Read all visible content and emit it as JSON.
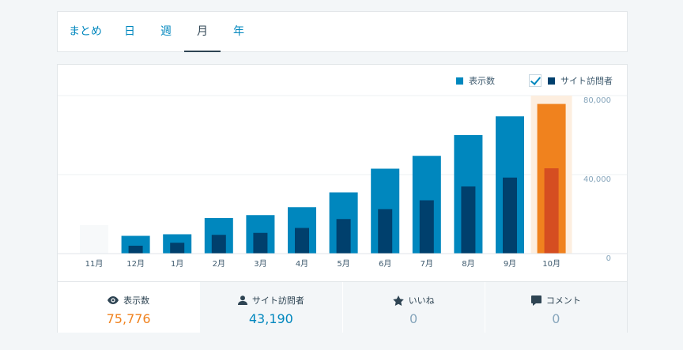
{
  "period_tabs": [
    {
      "label": "まとめ"
    },
    {
      "label": "日"
    },
    {
      "label": "週"
    },
    {
      "label": "月"
    },
    {
      "label": "年"
    }
  ],
  "active_period": "月",
  "legend": {
    "views_label": "表示数",
    "visitors_label": "サイト訪問者",
    "visitors_checked": true
  },
  "colors": {
    "views": "#0087be",
    "visitors": "#00406d",
    "selected_views": "#f0821e",
    "selected_visitors": "#d54e21",
    "selected_highlight": "#fdeedf"
  },
  "chart_data": {
    "type": "bar",
    "categories": [
      "11月",
      "12月",
      "1月",
      "2月",
      "3月",
      "4月",
      "5月",
      "6月",
      "7月",
      "8月",
      "9月",
      "10月"
    ],
    "series": [
      {
        "name": "表示数",
        "values": [
          0,
          9000,
          9800,
          18000,
          19500,
          23500,
          31000,
          43000,
          49500,
          60000,
          69500,
          75776
        ]
      },
      {
        "name": "サイト訪問者",
        "values": [
          0,
          4000,
          5500,
          9500,
          10500,
          13000,
          17500,
          22500,
          27000,
          34000,
          38500,
          43190
        ]
      }
    ],
    "selected_index": 11,
    "y_ticks": [
      "80,000",
      "40,000",
      "0"
    ],
    "y_tick_values": [
      80000,
      40000,
      0
    ],
    "ylim": [
      0,
      80000
    ],
    "grid": true
  },
  "summary": {
    "views": {
      "label": "表示数",
      "value": "75,776"
    },
    "visitors": {
      "label": "サイト訪問者",
      "value": "43,190"
    },
    "likes": {
      "label": "いいね",
      "value": "0"
    },
    "comments": {
      "label": "コメント",
      "value": "0"
    }
  }
}
